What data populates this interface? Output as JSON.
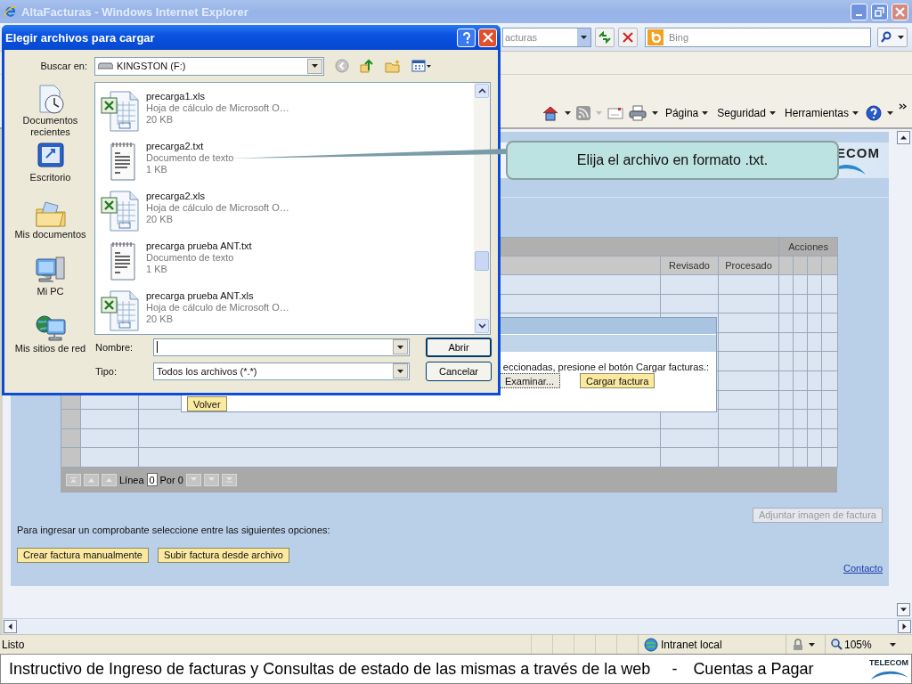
{
  "window": {
    "title": "AltaFacturas - Windows Internet Explorer"
  },
  "address_bar": {
    "value": "acturas"
  },
  "search": {
    "placeholder": "Bing"
  },
  "command_bar": {
    "items": [
      "Página",
      "Seguridad",
      "Herramientas"
    ]
  },
  "page": {
    "banner_logo": "ECOM",
    "table": {
      "group_header": "Acciones",
      "columns": [
        "Revisado",
        "Procesado"
      ]
    },
    "upload_panel": {
      "instruction": "eccionadas, presione el botón Cargar facturas.:",
      "browse_button": "Examinar...",
      "upload_button": "Cargar factura",
      "back_button": "Volver"
    },
    "pager": {
      "label": "Línea",
      "value": "0",
      "suffix": "Por 0"
    },
    "attach_button": {
      "label": "Adjuntar imagen de factura",
      "disabled": true
    },
    "prompt": "Para ingresar un comprobante seleccione entre las siguientes opciones:",
    "buttons": [
      "Crear factura manualmente",
      "Subir factura desde archivo"
    ],
    "contact_link": "Contacto"
  },
  "status_bar": {
    "status": "Listo",
    "zone": "Intranet local",
    "zoom": "105%"
  },
  "dialog": {
    "title": "Elegir archivos para cargar",
    "look_in_label": "Buscar en:",
    "look_in_value": "KINGSTON (F:)",
    "places": [
      {
        "label": "Documentos recientes",
        "kind": "recent"
      },
      {
        "label": "Escritorio",
        "kind": "desktop"
      },
      {
        "label": "Mis documentos",
        "kind": "documents"
      },
      {
        "label": "Mi PC",
        "kind": "computer"
      },
      {
        "label": "Mis sitios de red",
        "kind": "network"
      }
    ],
    "files": [
      {
        "name": "precarga1.xls",
        "type": "Hoja de cálculo de Microsoft O…",
        "size": "20 KB",
        "kind": "xls"
      },
      {
        "name": "precarga2.txt",
        "type": "Documento de texto",
        "size": "1 KB",
        "kind": "txt"
      },
      {
        "name": "precarga2.xls",
        "type": "Hoja de cálculo de Microsoft O…",
        "size": "20 KB",
        "kind": "xls"
      },
      {
        "name": "precarga prueba ANT.txt",
        "type": "Documento de texto",
        "size": "1 KB",
        "kind": "txt"
      },
      {
        "name": "precarga prueba ANT.xls",
        "type": "Hoja de cálculo de Microsoft O…",
        "size": "20 KB",
        "kind": "xls"
      }
    ],
    "name_label": "Nombre:",
    "type_label": "Tipo:",
    "type_value": "Todos los archivos (*.*)",
    "buttons": [
      "Abrir",
      "Cancelar"
    ]
  },
  "callout": {
    "text": "Elija el archivo en formato .txt."
  },
  "footer": {
    "text": "Instructivo de Ingreso de facturas y Consultas de estado de las mismas a través de la web",
    "separator": "-",
    "section": "Cuentas a Pagar",
    "logo": "TELECOM"
  }
}
